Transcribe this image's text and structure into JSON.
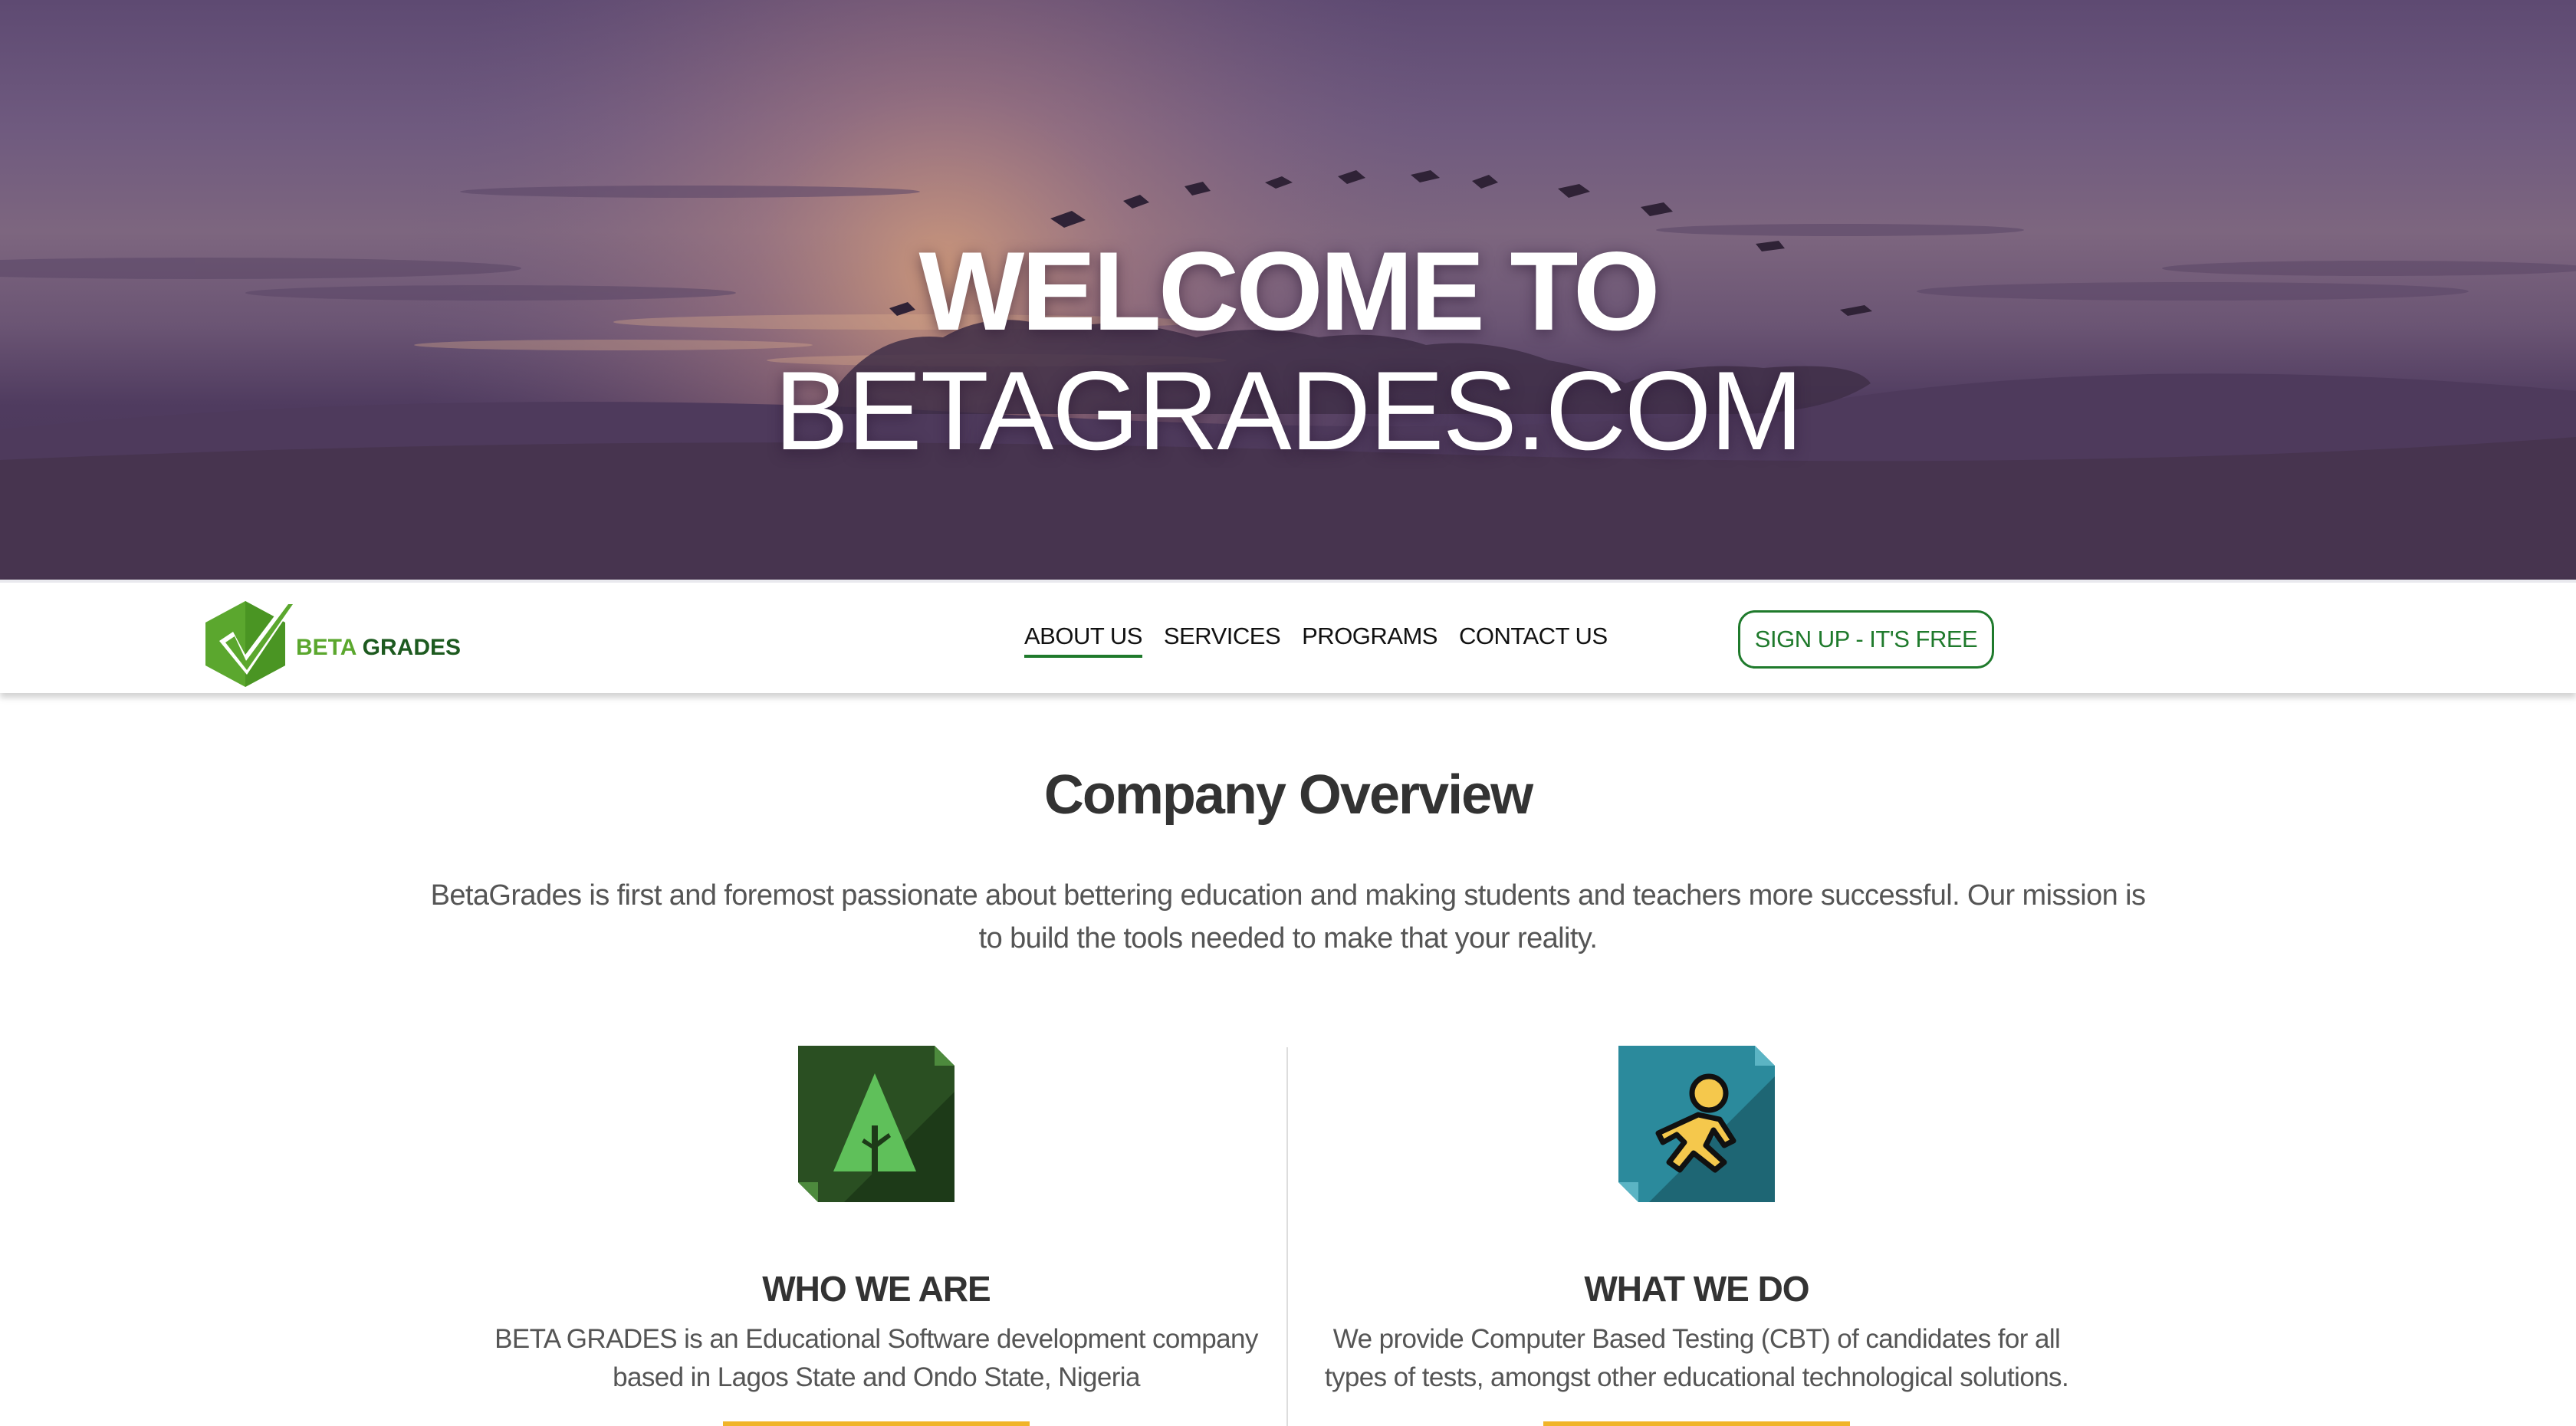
{
  "hero": {
    "line1": "WELCOME TO",
    "line2": "BETAGRADES.COM"
  },
  "nav": {
    "logo": {
      "beta": "BETA",
      "grades": "GRADES"
    },
    "links": [
      {
        "label": "ABOUT US",
        "active": true
      },
      {
        "label": "SERVICES",
        "active": false
      },
      {
        "label": "PROGRAMS",
        "active": false
      },
      {
        "label": "CONTACT US",
        "active": false
      }
    ],
    "signup_label": "SIGN UP - IT'S FREE"
  },
  "overview": {
    "title": "Company Overview",
    "intro": "BetaGrades is first and foremost passionate about bettering education and making students and teachers more successful. Our mission is to build the tools needed to make that your reality."
  },
  "features": [
    {
      "icon": "tree-icon",
      "title": "WHO WE ARE",
      "text": "BETA GRADES is an Educational Software development company based in Lagos State and Ondo State, Nigeria"
    },
    {
      "icon": "running-man-icon",
      "title": "WHAT WE DO",
      "text": "We provide Computer Based Testing (CBT) of candidates for all types of tests, amongst other educational technological solutions."
    }
  ],
  "colors": {
    "brand_green": "#1f7a2c",
    "logo_light_green": "#5ba72e",
    "accent_gold": "#f0b429",
    "hero_purple": "#5e4a72"
  }
}
